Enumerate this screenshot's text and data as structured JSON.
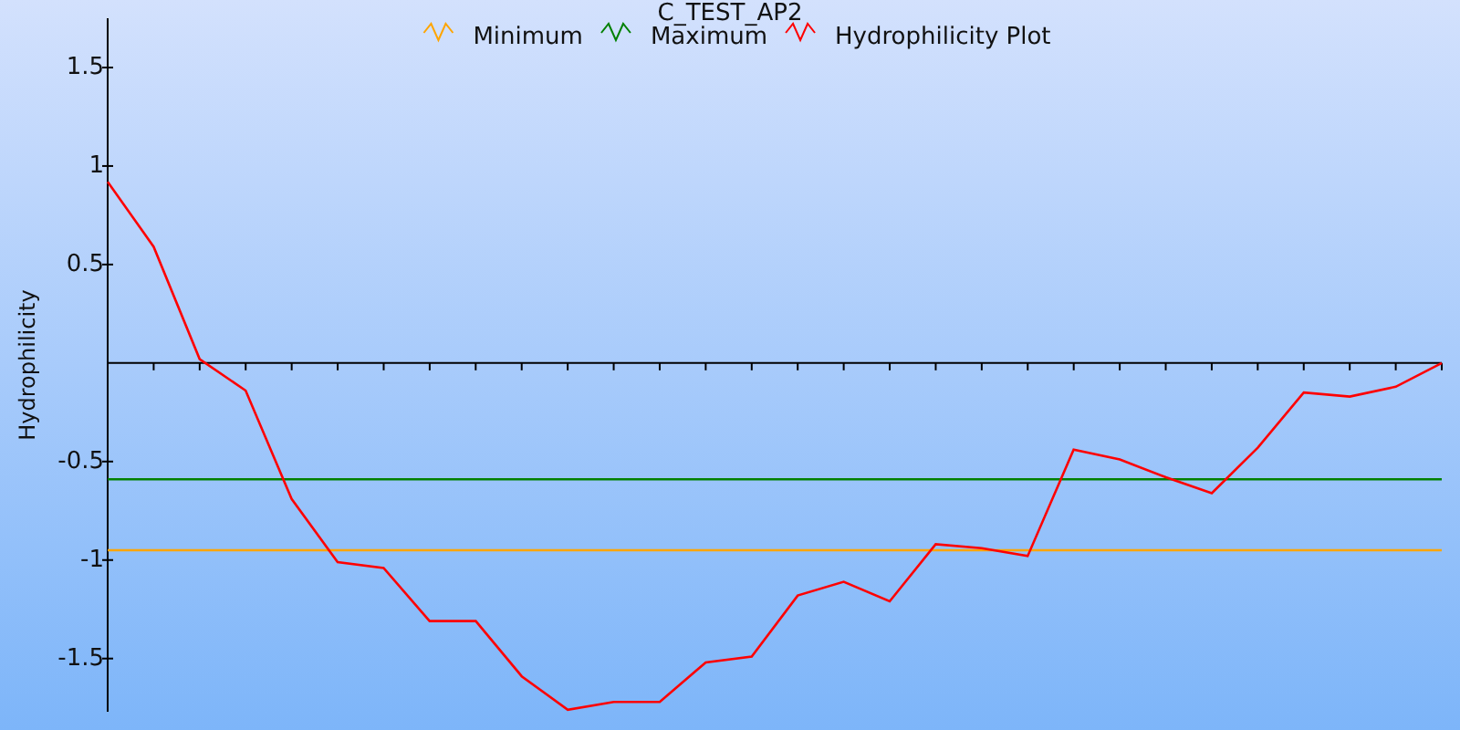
{
  "chart_data": {
    "type": "line",
    "title": "C_TEST_AP2",
    "ylabel": "Hydrophilicity",
    "categories": [
      null,
      null,
      null,
      null,
      null,
      null,
      null,
      null,
      null,
      null,
      null,
      null,
      null,
      null,
      null,
      null,
      null,
      null,
      null,
      null,
      null,
      null,
      null,
      null,
      null,
      null,
      null,
      null,
      null,
      null
    ],
    "legend": "top",
    "ylim": [
      -1.77,
      1.75
    ],
    "yticks": [
      1.5,
      1,
      0.5,
      -0.5,
      -1,
      -1.5
    ],
    "series": [
      {
        "name": "Minimum",
        "color": "#ffa500",
        "values": [
          -0.95,
          -0.95,
          -0.95,
          -0.95,
          -0.95,
          -0.95,
          -0.95,
          -0.95,
          -0.95,
          -0.95,
          -0.95,
          -0.95,
          -0.95,
          -0.95,
          -0.95,
          -0.95,
          -0.95,
          -0.95,
          -0.95,
          -0.95,
          -0.95,
          -0.95,
          -0.95,
          -0.95,
          -0.95,
          -0.95,
          -0.95,
          -0.95,
          -0.95,
          -0.95
        ]
      },
      {
        "name": "Maximum",
        "color": "#008000",
        "values": [
          -0.59,
          -0.59,
          -0.59,
          -0.59,
          -0.59,
          -0.59,
          -0.59,
          -0.59,
          -0.59,
          -0.59,
          -0.59,
          -0.59,
          -0.59,
          -0.59,
          -0.59,
          -0.59,
          -0.59,
          -0.59,
          -0.59,
          -0.59,
          -0.59,
          -0.59,
          -0.59,
          -0.59,
          -0.59,
          -0.59,
          -0.59,
          -0.59,
          -0.59,
          -0.59
        ]
      },
      {
        "name": "Hydrophilicity Plot",
        "color": "#ff0000",
        "values": [
          0.92,
          0.59,
          0.02,
          -0.14,
          -0.69,
          -1.01,
          -1.04,
          -1.31,
          -1.31,
          -1.59,
          -1.76,
          -1.72,
          -1.72,
          -1.52,
          -1.49,
          -1.18,
          -1.11,
          -1.21,
          -0.92,
          -0.94,
          -0.98,
          -0.44,
          -0.49,
          -0.58,
          -0.66,
          -0.43,
          -0.15,
          -0.17,
          -0.12,
          0.0
        ]
      }
    ]
  }
}
